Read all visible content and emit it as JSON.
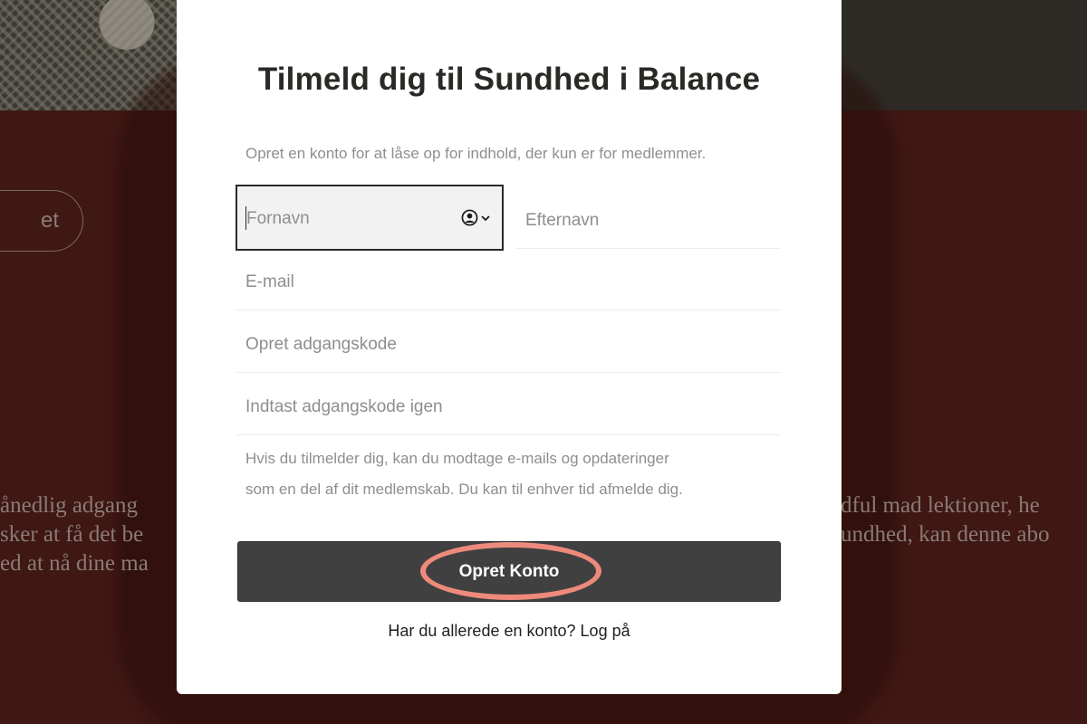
{
  "background": {
    "pill_button_text": "et",
    "text_left": [
      "ånedlig adgang",
      "sker at få det be",
      "ed at nå dine ma"
    ],
    "text_right": [
      "dful mad lektioner, he",
      "undhed, kan denne abo",
      ""
    ]
  },
  "modal": {
    "title": "Tilmeld dig til Sundhed i Balance",
    "subtitle": "Opret en konto for at låse op for indhold, der kun er for medlemmer.",
    "fields": {
      "first_name": "Fornavn",
      "last_name": "Efternavn",
      "email": "E-mail",
      "password": "Opret adgangskode",
      "password_repeat": "Indtast adgangskode igen"
    },
    "notice_lines": [
      "Hvis du tilmelder dig, kan du modtage e-mails og opdateringer",
      "som en del af dit medlemskab. Du kan til enhver tid afmelde dig."
    ],
    "submit_label": "Opret Konto",
    "login_prompt": "Har du allerede en konto?",
    "login_link": "Log på"
  },
  "colors": {
    "background": "#3f1713",
    "modal": "#ffffff",
    "button": "#404040",
    "highlight": "#ee8a7c"
  },
  "icons": [
    "person-circle-icon",
    "chevron-down-icon"
  ]
}
